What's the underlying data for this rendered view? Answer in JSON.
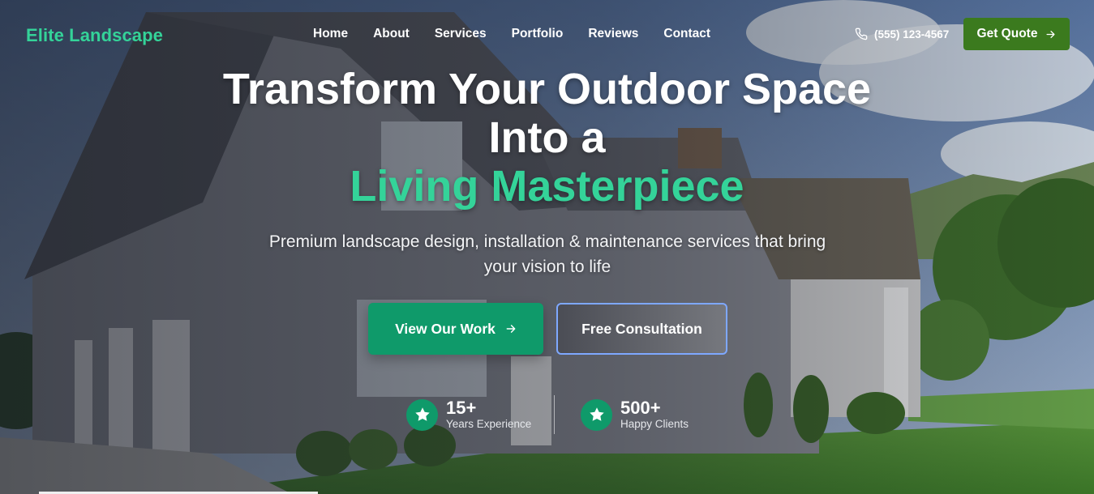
{
  "brand": {
    "name": "Elite Landscape",
    "color": "#34d399"
  },
  "nav": {
    "items": [
      {
        "label": "Home"
      },
      {
        "label": "About"
      },
      {
        "label": "Services"
      },
      {
        "label": "Portfolio"
      },
      {
        "label": "Reviews"
      },
      {
        "label": "Contact"
      }
    ],
    "phone": {
      "icon": "phone-icon",
      "text": "(555) 123-4567"
    },
    "cta": {
      "label": "Get Quote",
      "icon": "arrow-right-icon",
      "color": "#3b7a1e"
    }
  },
  "hero": {
    "title_line1": "Transform Your Outdoor Space",
    "title_line2": "Into a",
    "title_line3": "Living Masterpiece",
    "highlight_color": "#34d399",
    "subtitle": "Premium landscape design, installation & maintenance services that bring your vision to life",
    "primary_button": {
      "label": "View Our Work",
      "icon": "arrow-right-icon",
      "color": "#0f9a6a"
    },
    "secondary_button": {
      "label": "Free Consultation"
    }
  },
  "stats": [
    {
      "icon": "star-icon",
      "value": "15+",
      "label": "Years Experience"
    },
    {
      "icon": "star-icon",
      "value": "500+",
      "label": "Happy Clients"
    }
  ]
}
